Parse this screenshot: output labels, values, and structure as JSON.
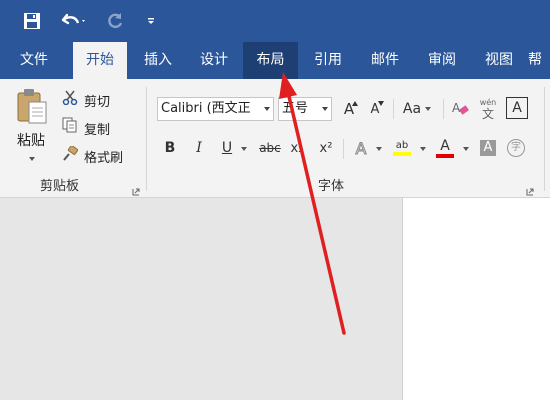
{
  "quick_access": {
    "save_icon": "save-icon",
    "undo_icon": "undo-icon",
    "redo_icon": "redo-icon",
    "customize_icon": "customize-qat-icon"
  },
  "tabs": [
    {
      "label": "文件"
    },
    {
      "label": "开始",
      "active": true
    },
    {
      "label": "插入"
    },
    {
      "label": "设计"
    },
    {
      "label": "布局"
    },
    {
      "label": "引用"
    },
    {
      "label": "邮件"
    },
    {
      "label": "审阅"
    },
    {
      "label": "视图"
    },
    {
      "label": "帮"
    }
  ],
  "clipboard": {
    "paste_label": "粘贴",
    "cut_label": "剪切",
    "copy_label": "复制",
    "format_painter_label": "格式刷",
    "group_label": "剪贴板"
  },
  "font": {
    "font_name": "Calibri (西文正",
    "font_size": "五号",
    "grow_label": "A",
    "shrink_label": "A",
    "change_case_label": "Aa",
    "wen_label": "wén",
    "wen_char": "文",
    "border_label": "A",
    "bold_label": "B",
    "italic_label": "I",
    "underline_label": "U",
    "strike_label": "abc",
    "subscript_label": "x₂",
    "superscript_label": "x²",
    "effects_label": "A",
    "highlight_label": "ab",
    "color_label": "A",
    "shade_label": "A",
    "circle_char": "字",
    "group_label": "字体"
  },
  "colors": {
    "title_blue": "#2b579a",
    "highlight_yellow": "#ffff00",
    "font_red": "#e00000",
    "arrow_red": "#e02020"
  }
}
